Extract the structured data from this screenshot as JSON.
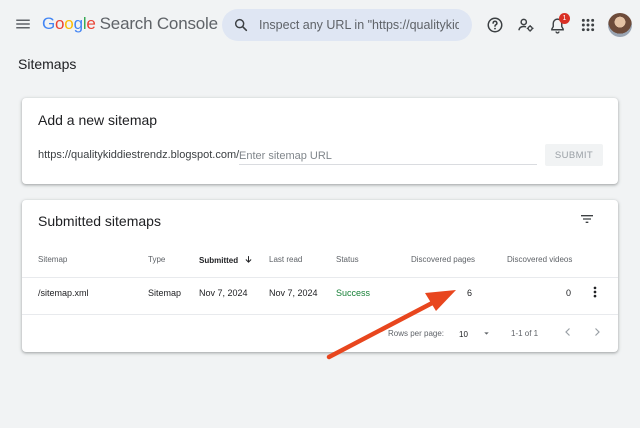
{
  "app": {
    "logo_letters": [
      "G",
      "o",
      "o",
      "g",
      "l",
      "e"
    ],
    "product_name": "Search Console"
  },
  "search": {
    "placeholder": "Inspect any URL in \"https://qualitykiddi"
  },
  "header": {
    "notification_count": "1"
  },
  "page": {
    "title": "Sitemaps"
  },
  "add_sitemap": {
    "title": "Add a new sitemap",
    "url_prefix": "https://qualitykiddiestrendz.blogspot.com/",
    "input_placeholder": "Enter sitemap URL",
    "submit_label": "SUBMIT"
  },
  "submitted": {
    "title": "Submitted sitemaps",
    "columns": {
      "sitemap": "Sitemap",
      "type": "Type",
      "submitted": "Submitted",
      "last_read": "Last read",
      "status": "Status",
      "discovered_pages": "Discovered pages",
      "discovered_videos": "Discovered videos"
    },
    "rows": [
      {
        "sitemap": "/sitemap.xml",
        "type": "Sitemap",
        "submitted": "Nov 7, 2024",
        "last_read": "Nov 7, 2024",
        "status": "Success",
        "discovered_pages": "6",
        "discovered_videos": "0"
      }
    ],
    "pagination": {
      "rows_per_page_label": "Rows per page:",
      "rows_per_page_value": "10",
      "range": "1-1 of 1"
    }
  },
  "colors": {
    "success": "#188038",
    "annotation_arrow": "#e8461e",
    "badge": "#d93025"
  }
}
